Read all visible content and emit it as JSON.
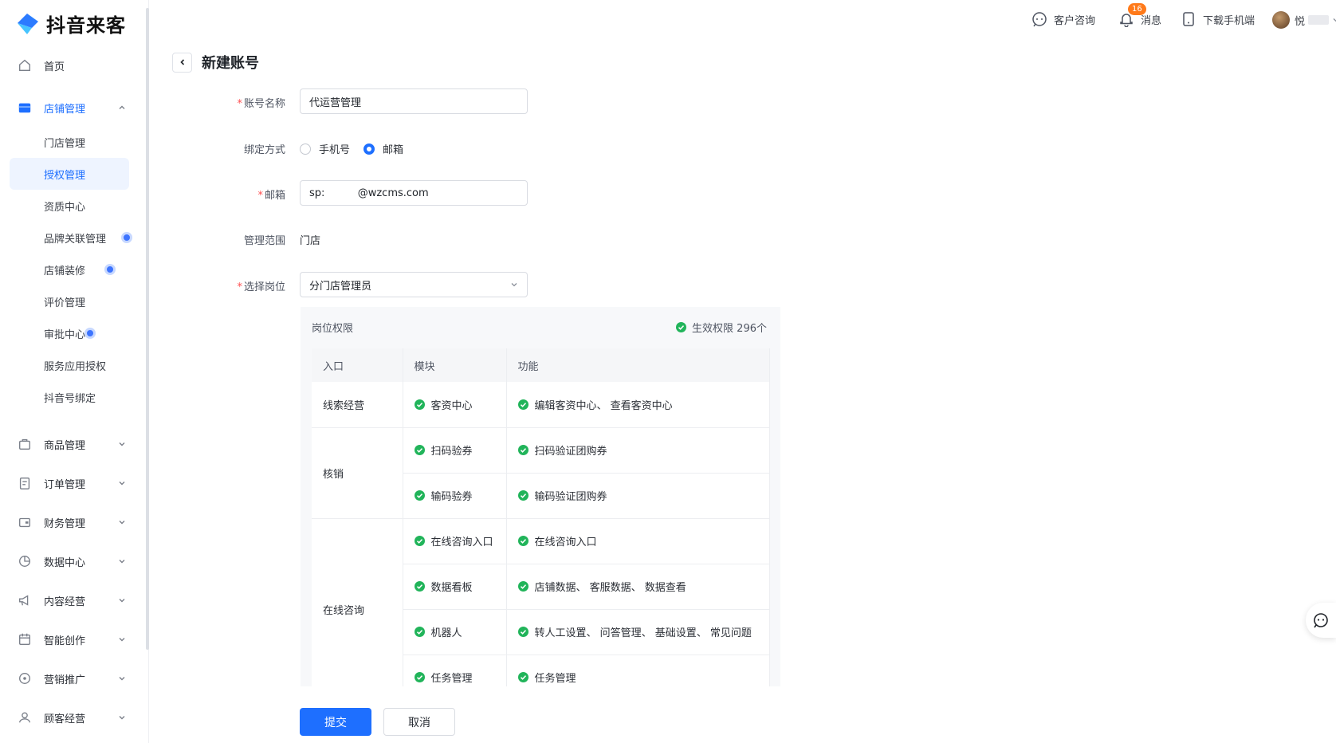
{
  "app": {
    "name": "抖音来客"
  },
  "sidebar": {
    "top_items": [
      {
        "label": "首页",
        "icon": "home-icon"
      },
      {
        "label": "店铺管理",
        "icon": "store-icon",
        "active": true,
        "expanded": true
      },
      {
        "label": "商品管理",
        "icon": "goods-icon"
      },
      {
        "label": "订单管理",
        "icon": "order-icon"
      },
      {
        "label": "财务管理",
        "icon": "wallet-icon"
      },
      {
        "label": "数据中心",
        "icon": "chart-pie-icon"
      },
      {
        "label": "内容经营",
        "icon": "megaphone-icon"
      },
      {
        "label": "智能创作",
        "icon": "calendar-icon"
      },
      {
        "label": "营销推广",
        "icon": "location-icon"
      },
      {
        "label": "顾客经营",
        "icon": "user-icon"
      }
    ],
    "sub_items": [
      {
        "label": "门店管理"
      },
      {
        "label": "授权管理",
        "selected": true
      },
      {
        "label": "资质中心"
      },
      {
        "label": "品牌关联管理",
        "dot": true
      },
      {
        "label": "店铺装修",
        "dot": true
      },
      {
        "label": "评价管理"
      },
      {
        "label": "审批中心",
        "dot": true
      },
      {
        "label": "服务应用授权"
      },
      {
        "label": "抖音号绑定"
      }
    ]
  },
  "topbar": {
    "consult": "客户咨询",
    "messages": "消息",
    "message_count": "16",
    "download": "下载手机端",
    "user": "悦"
  },
  "page": {
    "title": "新建账号"
  },
  "form": {
    "account_name_label": "账号名称",
    "account_name_value": "代运营管理",
    "bind_label": "绑定方式",
    "bind_options": [
      "手机号",
      "邮箱"
    ],
    "bind_selected": "邮箱",
    "email_label": "邮箱",
    "email_value": "sp:          @wzcms.com",
    "scope_label": "管理范围",
    "scope_value": "门店",
    "position_label": "选择岗位",
    "position_value": "分门店管理员"
  },
  "permissions": {
    "title": "岗位权限",
    "effective": "生效权限 296个",
    "columns": [
      "入口",
      "模块",
      "功能"
    ],
    "groups": [
      {
        "entry": "线索经营",
        "rows": [
          {
            "module": "客资中心",
            "func": "编辑客资中心、 查看客资中心"
          }
        ]
      },
      {
        "entry": "核销",
        "rows": [
          {
            "module": "扫码验券",
            "func": "扫码验证团购券"
          },
          {
            "module": "输码验券",
            "func": "输码验证团购券"
          }
        ]
      },
      {
        "entry": "在线咨询",
        "rows": [
          {
            "module": "在线咨询入口",
            "func": "在线咨询入口"
          },
          {
            "module": "数据看板",
            "func": "店铺数据、 客服数据、 数据查看"
          },
          {
            "module": "机器人",
            "func": "转人工设置、 问答管理、 基础设置、 常见问题"
          },
          {
            "module": "任务管理",
            "func": "任务管理"
          }
        ]
      }
    ]
  },
  "actions": {
    "submit": "提交",
    "cancel": "取消"
  },
  "colors": {
    "primary": "#1e6fff",
    "success": "#21b45a",
    "badge": "#ff7a1a"
  }
}
